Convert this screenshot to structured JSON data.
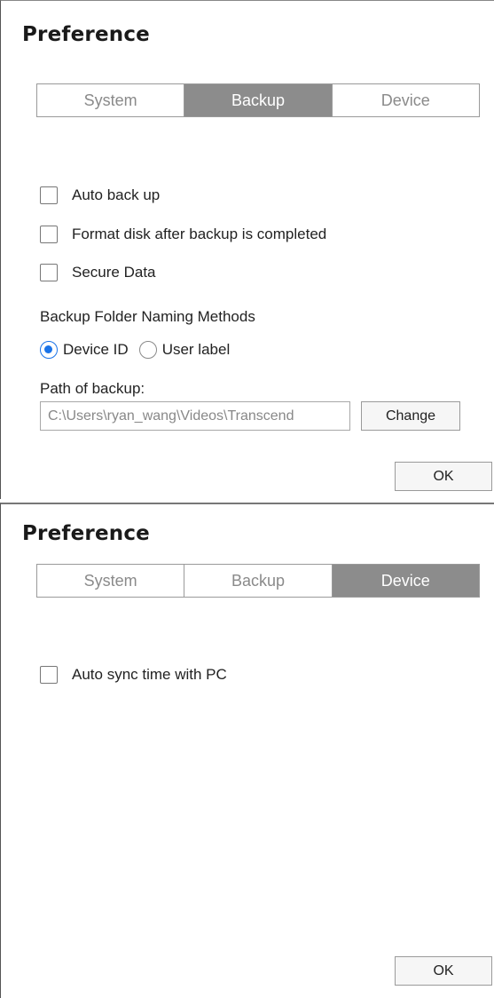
{
  "panel_backup": {
    "title": "Preference",
    "tabs": [
      {
        "label": "System",
        "active": false
      },
      {
        "label": "Backup",
        "active": true
      },
      {
        "label": "Device",
        "active": false
      }
    ],
    "options": [
      {
        "label": "Auto back up",
        "checked": false
      },
      {
        "label": "Format disk after backup is completed",
        "checked": false
      },
      {
        "label": "Secure Data",
        "checked": false
      }
    ],
    "naming_label": "Backup Folder Naming Methods",
    "naming_options": [
      {
        "label": "Device ID",
        "selected": true
      },
      {
        "label": "User label",
        "selected": false
      }
    ],
    "path_label": "Path of backup:",
    "path_value": "C:\\Users\\ryan_wang\\Videos\\Transcend",
    "change_label": "Change",
    "ok_label": "OK"
  },
  "panel_device": {
    "title": "Preference",
    "tabs": [
      {
        "label": "System",
        "active": false
      },
      {
        "label": "Backup",
        "active": false
      },
      {
        "label": "Device",
        "active": true
      }
    ],
    "options": [
      {
        "label": "Auto sync time with PC",
        "checked": false
      }
    ],
    "ok_label": "OK"
  },
  "colors": {
    "active_tab": "#8c8c8c",
    "radio_selected": "#1a73e8"
  }
}
